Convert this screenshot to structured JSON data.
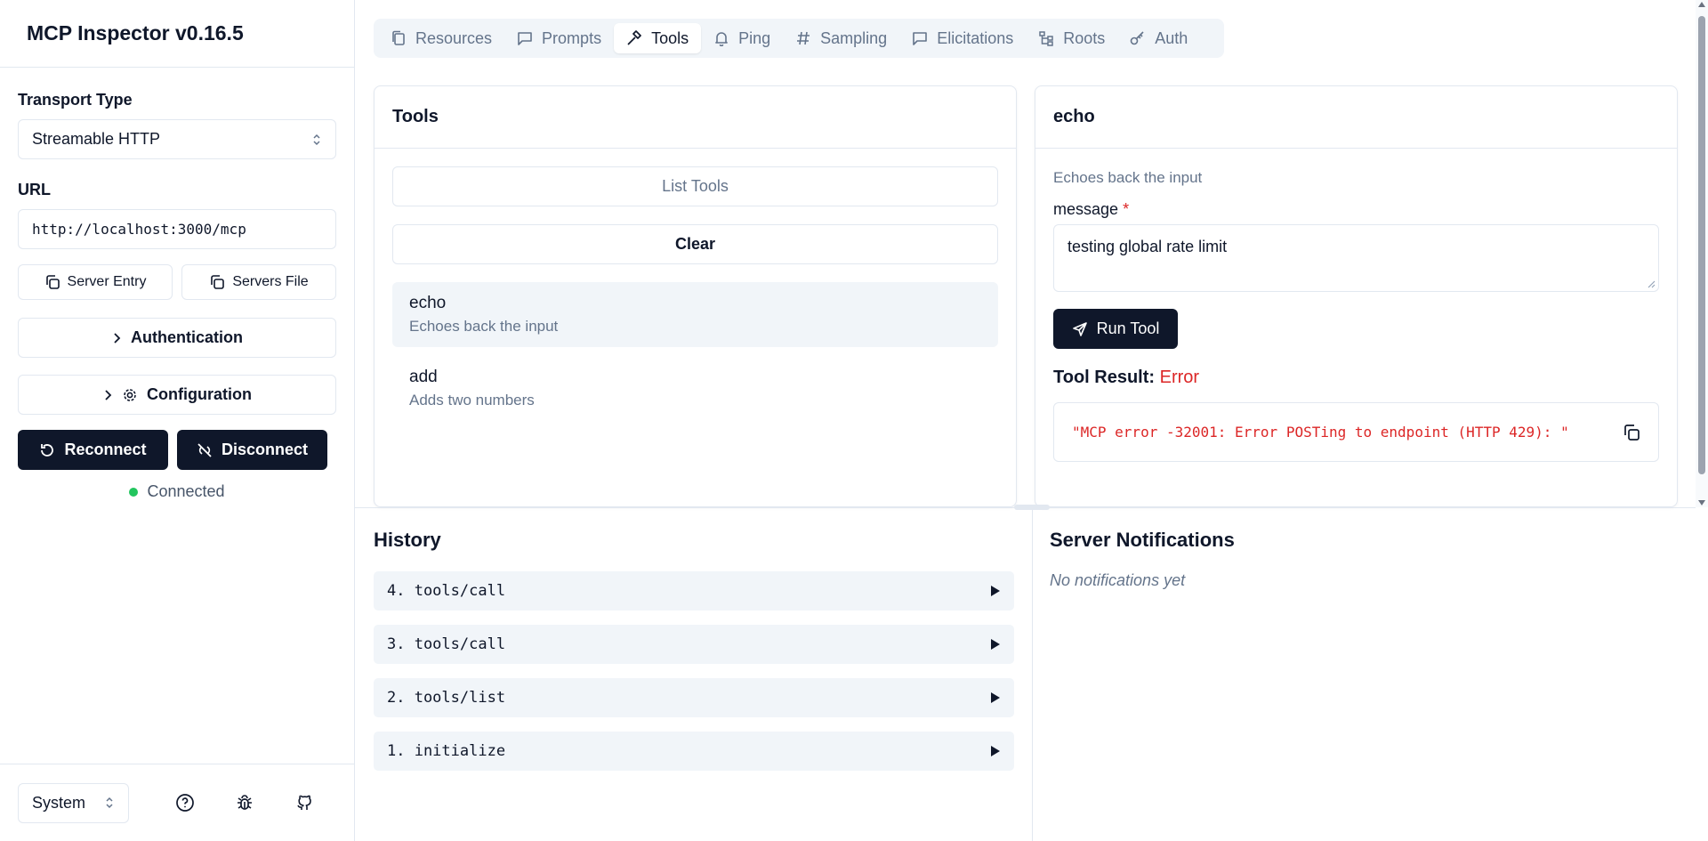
{
  "app": {
    "title": "MCP Inspector v0.16.5"
  },
  "sidebar": {
    "transport_label": "Transport Type",
    "transport_value": "Streamable HTTP",
    "url_label": "URL",
    "url_value": "http://localhost:3000/mcp",
    "server_entry_label": "Server Entry",
    "servers_file_label": "Servers File",
    "authentication_label": "Authentication",
    "configuration_label": "Configuration",
    "reconnect_label": "Reconnect",
    "disconnect_label": "Disconnect",
    "status_text": "Connected",
    "theme_value": "System"
  },
  "tabs": [
    {
      "label": "Resources",
      "icon": "files-icon",
      "active": false
    },
    {
      "label": "Prompts",
      "icon": "message-icon",
      "active": false
    },
    {
      "label": "Tools",
      "icon": "hammer-icon",
      "active": true
    },
    {
      "label": "Ping",
      "icon": "bell-icon",
      "active": false
    },
    {
      "label": "Sampling",
      "icon": "hash-icon",
      "active": false
    },
    {
      "label": "Elicitations",
      "icon": "message-icon",
      "active": false
    },
    {
      "label": "Roots",
      "icon": "tree-icon",
      "active": false
    },
    {
      "label": "Auth",
      "icon": "key-icon",
      "active": false
    }
  ],
  "tools_panel": {
    "title": "Tools",
    "list_button": "List Tools",
    "clear_button": "Clear",
    "items": [
      {
        "name": "echo",
        "description": "Echoes back the input"
      },
      {
        "name": "add",
        "description": "Adds two numbers"
      }
    ]
  },
  "detail_panel": {
    "title": "echo",
    "description": "Echoes back the input",
    "param_label": "message",
    "required_mark": "*",
    "param_value": "testing global rate limit",
    "run_button": "Run Tool",
    "result_label": "Tool Result:",
    "result_status": "Error",
    "result_text": "\"MCP error -32001: Error POSTing to endpoint (HTTP 429): \""
  },
  "history": {
    "title": "History",
    "items": [
      "4. tools/call",
      "3. tools/call",
      "2. tools/list",
      "1. initialize"
    ]
  },
  "notifications": {
    "title": "Server Notifications",
    "empty_text": "No notifications yet"
  },
  "colors": {
    "accent_dark": "#0f172a",
    "error": "#dc2626",
    "connected": "#22c55e"
  }
}
